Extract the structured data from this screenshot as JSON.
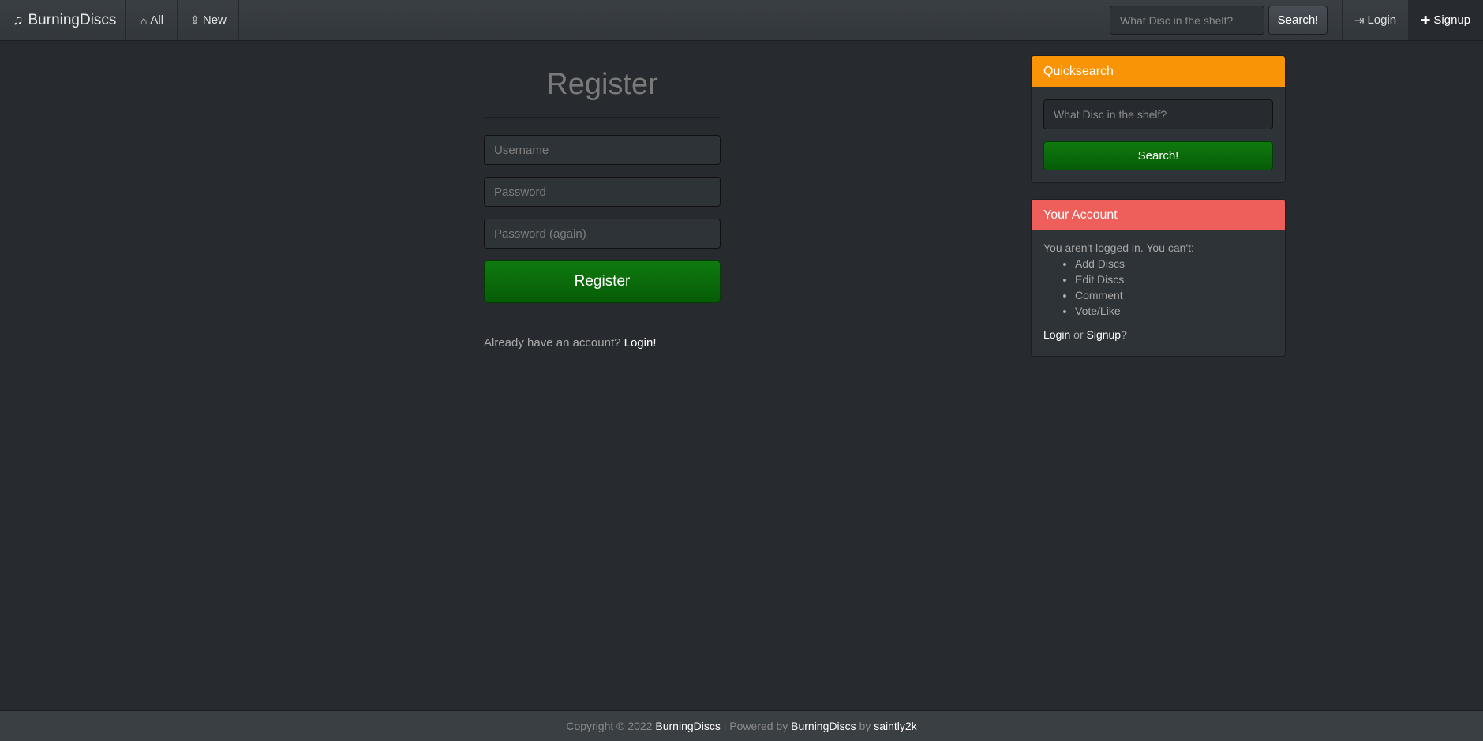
{
  "navbar": {
    "brand": "BurningDiscs",
    "brand_icon": "music-note-icon",
    "all_label": "All",
    "new_label": "New",
    "search_placeholder": "What Disc in the shelf?",
    "search_button": "Search!",
    "login_label": "Login",
    "signup_label": "Signup"
  },
  "register": {
    "title": "Register",
    "username_placeholder": "Username",
    "password_placeholder": "Password",
    "password_again_placeholder": "Password (again)",
    "submit_label": "Register",
    "already_text": "Already have an account?",
    "login_link": "Login!"
  },
  "quicksearch": {
    "title": "Quicksearch",
    "placeholder": "What Disc in the shelf?",
    "button": "Search!"
  },
  "account": {
    "title": "Your Account",
    "intro": "You aren't logged in. You can't:",
    "items": [
      "Add Discs",
      "Edit Discs",
      "Comment",
      "Vote/Like"
    ],
    "login_link": "Login",
    "or_text": "or",
    "signup_link": "Signup",
    "question": "?"
  },
  "footer": {
    "copyright": "Copyright © 2022",
    "site": "BurningDiscs",
    "powered_text": "| Powered by",
    "powered_link": "BurningDiscs",
    "by_text": "by",
    "author": "saintly2k"
  },
  "colors": {
    "background": "#272b30",
    "quicksearch_header": "#f89406",
    "account_header": "#ee5f5b",
    "primary_button": "#0f7a0f"
  }
}
